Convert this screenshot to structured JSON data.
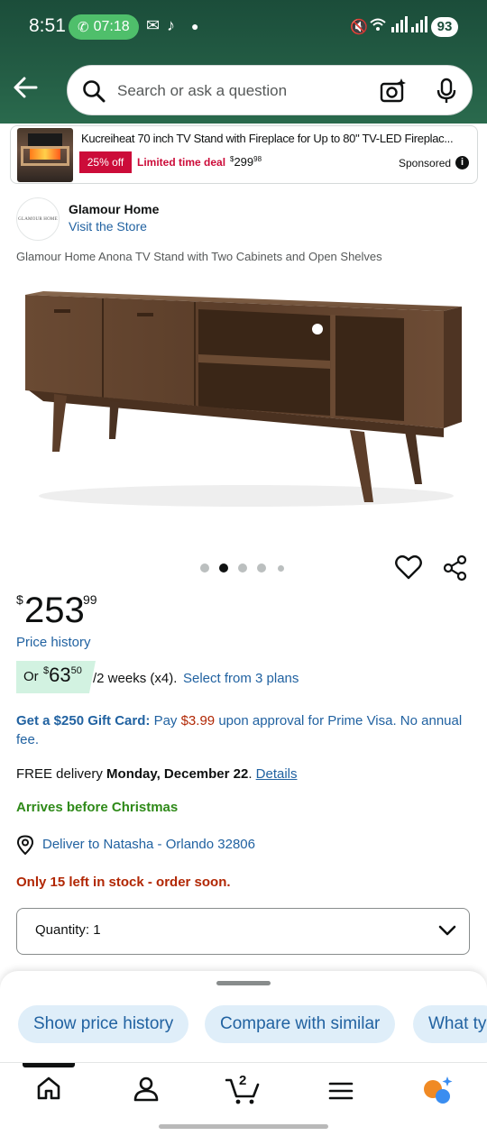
{
  "status_bar": {
    "time": "8:51",
    "call_timer": "07:18",
    "battery": "93"
  },
  "search": {
    "placeholder": "Search or ask a question"
  },
  "sponsored_ad": {
    "title": "Kucreiheat 70 inch TV Stand with Fireplace for Up to 80\" TV-LED Fireplac...",
    "discount_badge": "25% off",
    "deal_label": "Limited time deal",
    "price_symbol": "$",
    "price_whole": "299",
    "price_fraction": "98",
    "sponsored_label": "Sponsored"
  },
  "brand": {
    "logo_text": "GLAMOUR HOME",
    "name": "Glamour Home",
    "visit_store": "Visit the Store"
  },
  "product": {
    "title": "Glamour Home Anona TV Stand with Two Cabinets and Open Shelves",
    "image_count": 5,
    "active_image_index": 1
  },
  "price": {
    "symbol": "$",
    "whole": "253",
    "fraction": "99",
    "history_link": "Price history"
  },
  "installment": {
    "prefix": "Or",
    "symbol": "$",
    "amount_whole": "63",
    "amount_fraction": "50",
    "period": "/2 weeks (x4).",
    "plans_link": "Select from 3 plans"
  },
  "gift_card": {
    "lead": "Get a $250 Gift Card:",
    "pay_text": "Pay",
    "amount": "$3.99",
    "rest": "upon approval for Prime Visa. No annual fee."
  },
  "delivery": {
    "prefix": "FREE delivery",
    "date": "Monday, December 22",
    "period": ".",
    "details_link": "Details",
    "arrives": "Arrives before Christmas",
    "deliver_to": "Deliver to Natasha - Orlando 32806",
    "stock": "Only 15 left in stock - order soon."
  },
  "quantity": {
    "label": "Quantity:",
    "value": "1"
  },
  "suggestions": [
    "Show price history",
    "Compare with similar",
    "What ty"
  ],
  "nav": {
    "cart_count": "2"
  },
  "colors": {
    "header_green": "#235c44",
    "link_blue": "#2162a1",
    "deal_red": "#cc0c39",
    "price_red": "#b12704",
    "arrives_green": "#2f8a19",
    "chip_bg": "#dfeef9",
    "installment_bg": "#d2f2e1"
  }
}
